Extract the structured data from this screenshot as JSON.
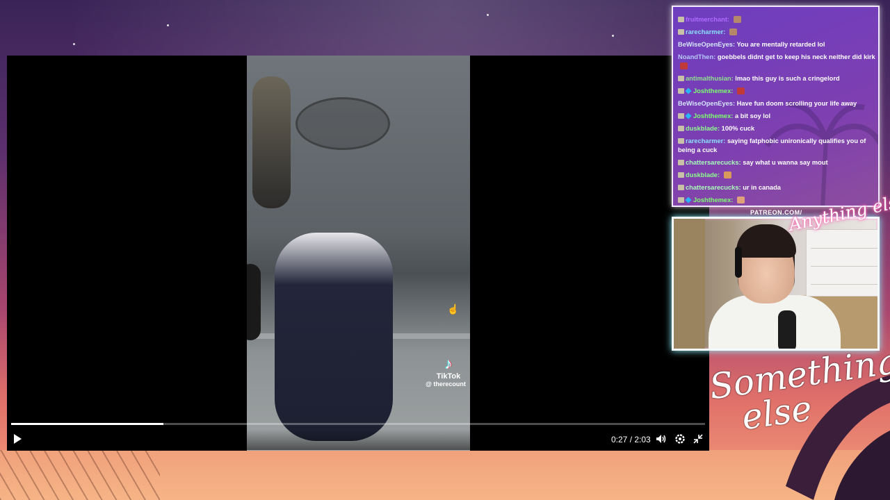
{
  "player": {
    "time_current": "0:27",
    "time_total": "2:03",
    "progress_fraction": 0.219,
    "icons": [
      "play-icon",
      "volume-icon",
      "settings-icon",
      "exit-fullscreen-icon"
    ]
  },
  "video": {
    "watermark_brand": "TikTok",
    "watermark_user": "@ therecount"
  },
  "chat": {
    "messages": [
      {
        "user": "fruitmerchant",
        "text": "",
        "color": "#b06bff",
        "badges": 1,
        "emote": "#b5876b"
      },
      {
        "user": "rarecharmer",
        "text": "",
        "color": "#8be0ff",
        "badges": 1,
        "emote": "#b5876b"
      },
      {
        "user": "BeWiseOpenEyes",
        "text": "You are mentally retarded lol",
        "color": "#d6e6ff",
        "badges": 0,
        "emote": ""
      },
      {
        "user": "NoandThen",
        "text": "goebbels didnt get to keep his neck neither did kirk",
        "color": "#b7c9ff",
        "badges": 0,
        "emote": "#c03a3a"
      },
      {
        "user": "antimalthusian",
        "text": "lmao this guy is such a cringelord",
        "color": "#8ee28b",
        "badges": 1,
        "emote": ""
      },
      {
        "user": "Joshthemex",
        "text": "",
        "color": "#7cff6e",
        "badges": 2,
        "emote": "#c03a3a"
      },
      {
        "user": "BeWiseOpenEyes",
        "text": "Have fun doom scrolling your life away",
        "color": "#d6e6ff",
        "badges": 0,
        "emote": ""
      },
      {
        "user": "Joshthemex",
        "text": "a bit soy lol",
        "color": "#7cff6e",
        "badges": 2,
        "emote": ""
      },
      {
        "user": "duskblade",
        "text": "100% cuck",
        "color": "#8cff8c",
        "badges": 1,
        "emote": ""
      },
      {
        "user": "rarecharmer",
        "text": "saying fatphobic unironically qualifies you of being a cuck",
        "color": "#8be0ff",
        "badges": 1,
        "emote": ""
      },
      {
        "user": "chattersarecucks",
        "text": "say what u wanna say mout",
        "color": "#a8ffb8",
        "badges": 1,
        "emote": ""
      },
      {
        "user": "duskblade",
        "text": "",
        "color": "#8cff8c",
        "badges": 1,
        "emote": "#d99a5b"
      },
      {
        "user": "chattersarecucks",
        "text": "ur in canada",
        "color": "#a8ffb8",
        "badges": 1,
        "emote": ""
      },
      {
        "user": "Joshthemex",
        "text": "",
        "color": "#7cff6e",
        "badges": 2,
        "emote": "#e0a07a"
      }
    ]
  },
  "overlay": {
    "patreon": "PATREON.COM/",
    "brand_small": "Anything else?",
    "brand_big_line1": "Something",
    "brand_big_line2": "else"
  }
}
